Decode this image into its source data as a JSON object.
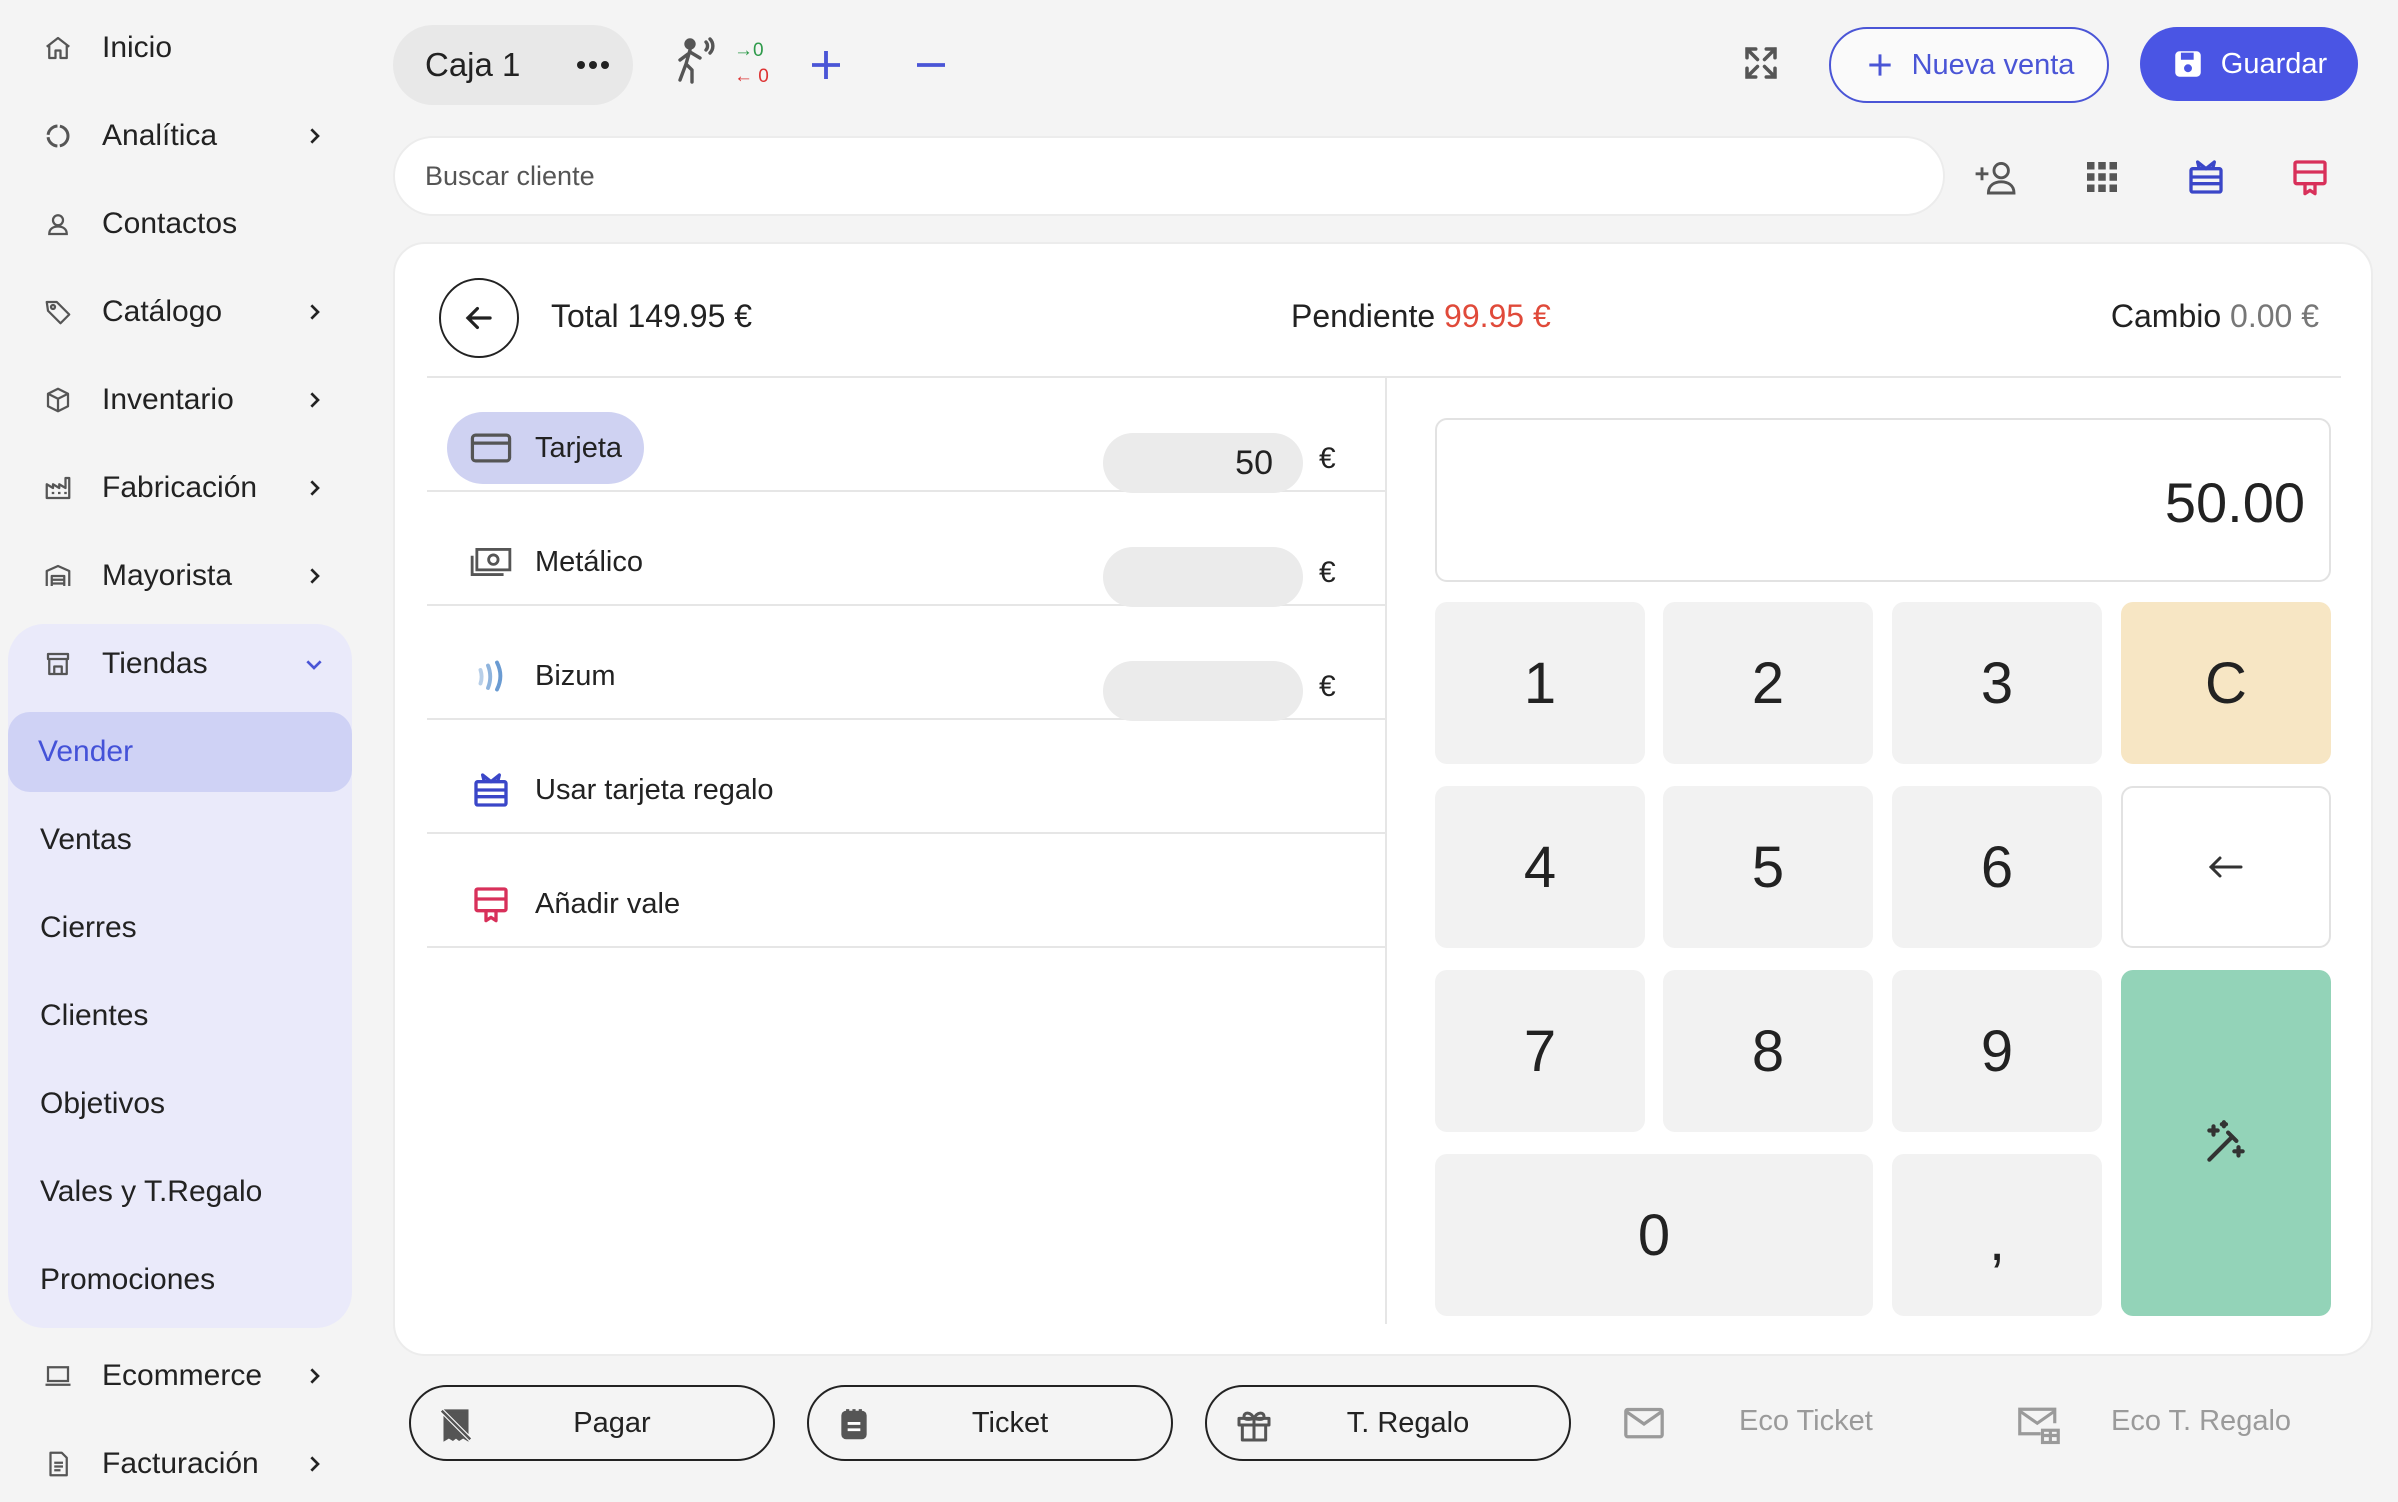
{
  "sidebar": {
    "items": [
      {
        "label": "Inicio",
        "icon": "home-icon"
      },
      {
        "label": "Analítica",
        "icon": "chart-pie-icon"
      },
      {
        "label": "Contactos",
        "icon": "user-icon"
      },
      {
        "label": "Catálogo",
        "icon": "tag-icon"
      },
      {
        "label": "Inventario",
        "icon": "box-icon"
      },
      {
        "label": "Fabricación",
        "icon": "factory-icon"
      },
      {
        "label": "Mayorista",
        "icon": "warehouse-icon"
      },
      {
        "label": "Tiendas",
        "icon": "store-icon"
      },
      {
        "label": "Ecommerce",
        "icon": "laptop-icon"
      },
      {
        "label": "Facturación",
        "icon": "invoice-icon"
      }
    ],
    "tiendas_sub": [
      "Vender",
      "Ventas",
      "Cierres",
      "Clientes",
      "Objetivos",
      "Vales y T.Regalo",
      "Promociones"
    ],
    "active_sub": "Vender"
  },
  "topbar": {
    "caja_label": "Caja 1",
    "count_in": "0",
    "count_out": "0",
    "nueva_venta": "Nueva venta",
    "guardar": "Guardar"
  },
  "search": {
    "placeholder": "Buscar cliente"
  },
  "payment": {
    "total_label": "Total",
    "total_value": "149.95 €",
    "pendiente_label": "Pendiente",
    "pendiente_value": "99.95 €",
    "cambio_label": "Cambio",
    "cambio_value": "0.00 €",
    "methods": [
      {
        "label": "Tarjeta",
        "amount": "50",
        "currency": "€"
      },
      {
        "label": "Metálico",
        "amount": "",
        "currency": "€"
      },
      {
        "label": "Bizum",
        "amount": "",
        "currency": "€"
      }
    ],
    "extras": [
      "Usar tarjeta regalo",
      "Añadir vale"
    ]
  },
  "keypad": {
    "display": "50.00",
    "keys": [
      "1",
      "2",
      "3",
      "C",
      "4",
      "5",
      "6",
      "7",
      "8",
      "9",
      "0",
      ","
    ]
  },
  "bottombar": {
    "pagar": "Pagar",
    "ticket": "Ticket",
    "t_regalo": "T. Regalo",
    "eco_ticket": "Eco Ticket",
    "eco_t_regalo": "Eco T. Regalo"
  },
  "colors": {
    "accent": "#4a55e4",
    "pending_red": "#e04a3a",
    "clear_key": "#f7e6c4",
    "enter_key": "#93d3b8",
    "sidebar_group": "#eaeafa",
    "gift_red": "#d8305a"
  }
}
